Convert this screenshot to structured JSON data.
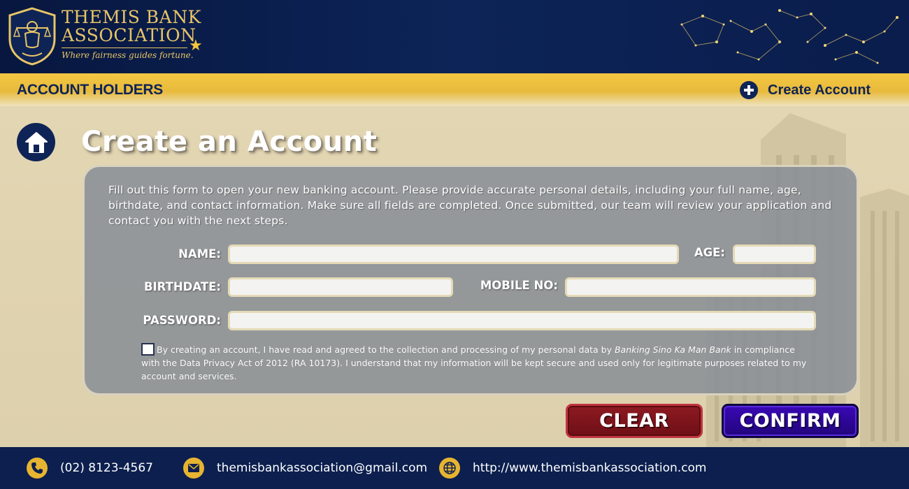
{
  "brand": {
    "line1": "THEMIS BANK",
    "line2": "ASSOCIATION",
    "tagline": "Where fairness guides fortune.",
    "logo_icon": "themis-scales-shield-icon"
  },
  "subnav": {
    "title": "ACCOUNT HOLDERS",
    "create_label": "Create Account",
    "create_icon": "plus-circle-icon"
  },
  "page": {
    "title": "Create an Account",
    "home_icon": "home-icon"
  },
  "form": {
    "intro": "Fill out this form to open your new banking account. Please provide accurate personal details, including your full name, age, birthdate, and contact information. Make sure all fields are completed. Once submitted, our team will review your application and contact you with the next steps.",
    "name_label": "NAME:",
    "name_value": "",
    "age_label": "AGE:",
    "age_value": "",
    "birthdate_label": "BIRTHDATE:",
    "birthdate_value": "",
    "mobile_label": "MOBILE NO:",
    "mobile_value": "",
    "password_label": "PASSWORD:",
    "password_value": "",
    "consent_checked": false,
    "consent_before": "By creating an account, I have read and agreed to the collection and processing of my personal data by ",
    "consent_bank": "Banking Sino Ka Man Bank",
    "consent_after": " in compliance with the Data Privacy Act of 2012 (RA 10173). I understand that my information will be kept secure and used only for legitimate purposes related to my account and services."
  },
  "buttons": {
    "clear": "CLEAR",
    "confirm": "CONFIRM"
  },
  "footer": {
    "phone": "(02) 8123-4567",
    "email": "themisbankassociation@gmail.com",
    "website": "http://www.themisbankassociation.com",
    "phone_icon": "phone-icon",
    "email_icon": "mail-icon",
    "website_icon": "globe-icon"
  },
  "colors": {
    "navy": "#0f2456",
    "gold": "#e8c567",
    "clear_red": "#8d1a22",
    "confirm_purple": "#3a08b5"
  }
}
